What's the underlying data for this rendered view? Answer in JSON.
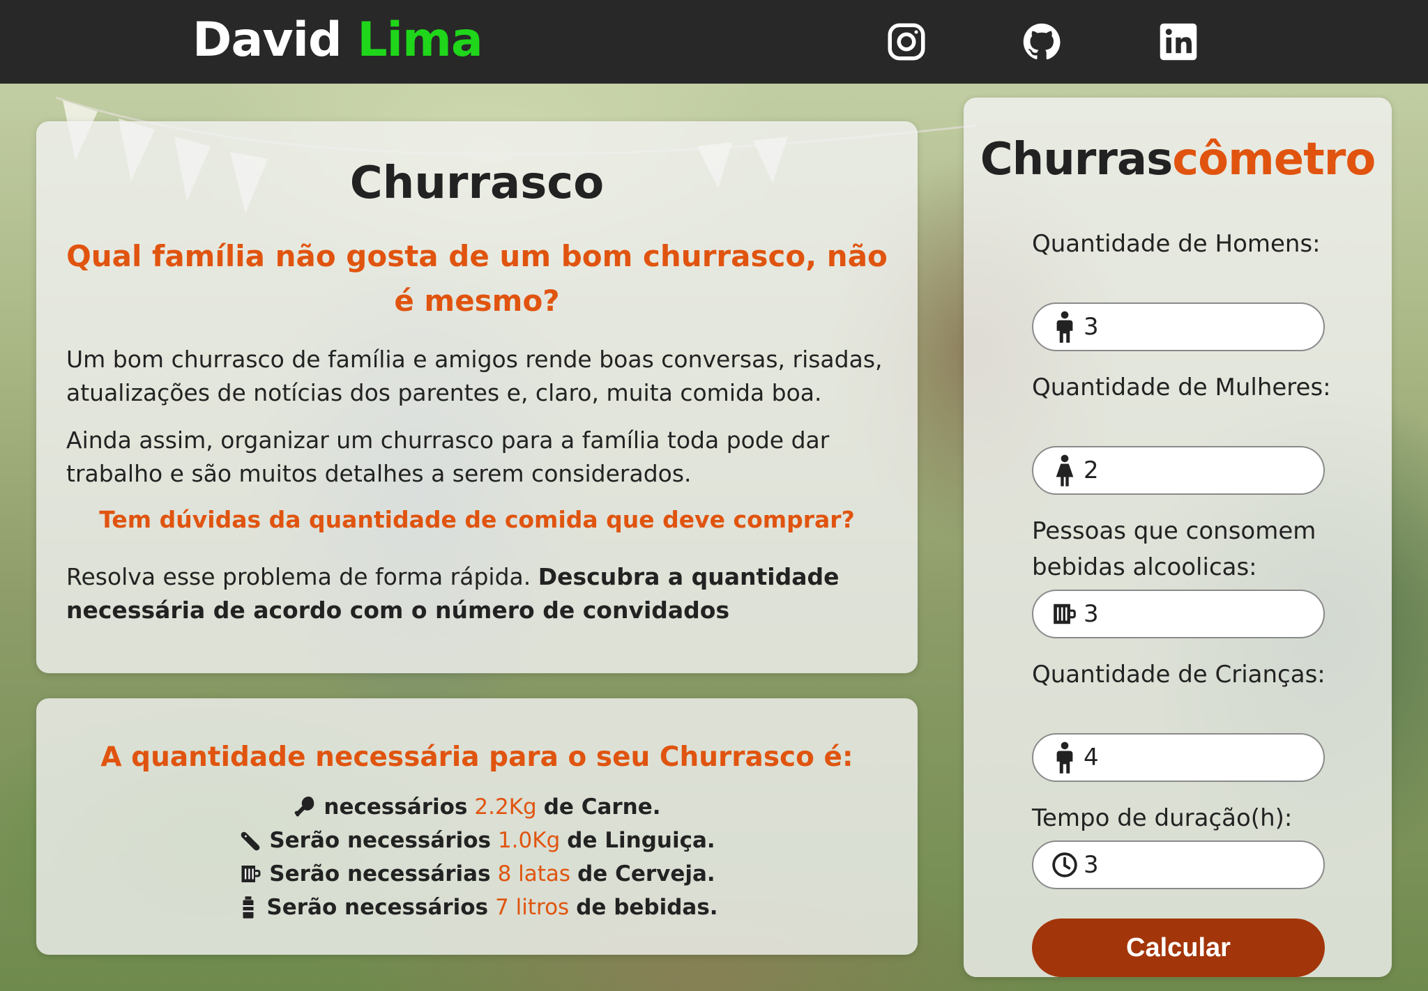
{
  "header": {
    "brand_first": "David",
    "brand_last": "Lima",
    "brand_accent_color": "#1fd61a",
    "social": [
      "instagram-icon",
      "github-icon",
      "linkedin-icon"
    ]
  },
  "intro": {
    "title": "Churrasco",
    "subtitle": "Qual família não gosta de um bom churrasco, não é mesmo?",
    "p1": "Um bom churrasco de família e amigos rende boas conversas, risadas, atualizações de notícias dos parentes e, claro, muita comida boa.",
    "p2": "Ainda assim, organizar um churrasco para a família toda pode dar trabalho e são muitos detalhes a serem considerados.",
    "p3": "Tem dúvidas da quantidade de comida que deve comprar?",
    "p4_plain": "Resolva esse problema de forma rápida.",
    "p4_bold": "Descubra a quantidade necessária de acordo com o número de convidados"
  },
  "result": {
    "title": "A quantidade necessária para o seu Churrasco é:",
    "lines": [
      {
        "icon": "drumstick-icon",
        "before": "necessários",
        "value": "2.2Kg",
        "after": "de Carne."
      },
      {
        "icon": "sausage-icon",
        "before": "Serão necessários",
        "value": "1.0Kg",
        "after": "de Linguiça."
      },
      {
        "icon": "beer-mug-icon",
        "before": "Serão necessárias",
        "value": "8 latas",
        "after": "de Cerveja."
      },
      {
        "icon": "bottle-icon",
        "before": "Serão necessários",
        "value": "7 litros",
        "after": "de bebidas."
      }
    ]
  },
  "calc": {
    "title_first": "Churras",
    "title_accent": "cômetro",
    "fields": [
      {
        "label": "Quantidade de Homens:",
        "value": "3",
        "icon": "male-person-icon"
      },
      {
        "label": "Quantidade de Mulheres:",
        "value": "2",
        "icon": "female-person-icon"
      },
      {
        "label": "Pessoas que consomem bebidas alcoolicas:",
        "value": "3",
        "icon": "beer-mug-icon"
      },
      {
        "label": "Quantidade de Crianças:",
        "value": "4",
        "icon": "child-icon"
      },
      {
        "label": "Tempo de duração(h):",
        "value": "3",
        "icon": "clock-icon"
      }
    ],
    "button_label": "Calcular"
  },
  "colors": {
    "accent": "#e0540f",
    "button": "#a3350a",
    "header_bg": "#282828"
  }
}
